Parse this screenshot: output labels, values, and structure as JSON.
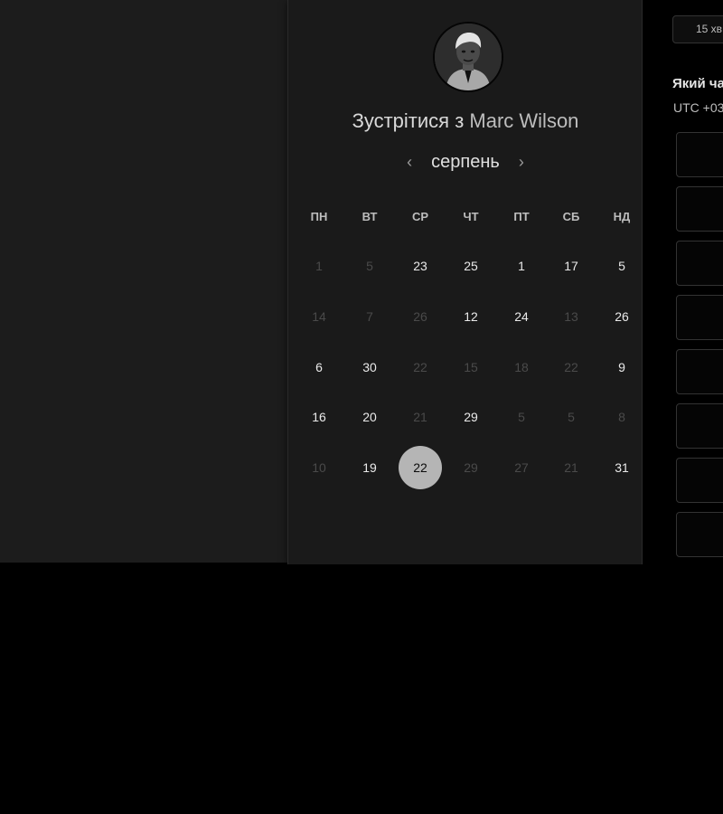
{
  "booking": {
    "title_prefix": "Зустрітися з",
    "host_name": "Marc Wilson",
    "avatar_icon": "person-portrait-icon",
    "month_label": "серпень",
    "prev_icon": "chevron-left-icon",
    "next_icon": "chevron-right-icon",
    "prev_glyph": "‹",
    "next_glyph": "›",
    "weekdays": [
      "ПН",
      "ВТ",
      "СР",
      "ЧТ",
      "ПТ",
      "СБ",
      "НД"
    ],
    "weeks": [
      [
        {
          "d": "1",
          "on": false
        },
        {
          "d": "5",
          "on": false
        },
        {
          "d": "23",
          "on": true
        },
        {
          "d": "25",
          "on": true
        },
        {
          "d": "1",
          "on": true
        },
        {
          "d": "17",
          "on": true
        },
        {
          "d": "5",
          "on": true
        }
      ],
      [
        {
          "d": "14",
          "on": false
        },
        {
          "d": "7",
          "on": false
        },
        {
          "d": "26",
          "on": false
        },
        {
          "d": "12",
          "on": true
        },
        {
          "d": "24",
          "on": true
        },
        {
          "d": "13",
          "on": false
        },
        {
          "d": "26",
          "on": true
        }
      ],
      [
        {
          "d": "6",
          "on": true
        },
        {
          "d": "30",
          "on": true
        },
        {
          "d": "22",
          "on": false
        },
        {
          "d": "15",
          "on": false
        },
        {
          "d": "18",
          "on": false
        },
        {
          "d": "22",
          "on": false
        },
        {
          "d": "9",
          "on": true
        }
      ],
      [
        {
          "d": "16",
          "on": true
        },
        {
          "d": "20",
          "on": true
        },
        {
          "d": "21",
          "on": false
        },
        {
          "d": "29",
          "on": true
        },
        {
          "d": "5",
          "on": false
        },
        {
          "d": "5",
          "on": false
        },
        {
          "d": "8",
          "on": false
        }
      ],
      [
        {
          "d": "10",
          "on": false
        },
        {
          "d": "19",
          "on": true
        },
        {
          "d": "22",
          "on": true,
          "selected": true
        },
        {
          "d": "29",
          "on": false
        },
        {
          "d": "27",
          "on": false
        },
        {
          "d": "21",
          "on": false
        },
        {
          "d": "31",
          "on": true
        }
      ]
    ]
  },
  "timeslots": {
    "duration_label": "15 хв",
    "question": "Який ча",
    "timezone": "UTC +03",
    "slot_count": 8
  },
  "colors": {
    "selected_day_bg": "#b5b5b5",
    "available_day": "#eaeaea",
    "unavailable_day": "#4a4a4a",
    "panel_bg": "#1a1a1a"
  }
}
